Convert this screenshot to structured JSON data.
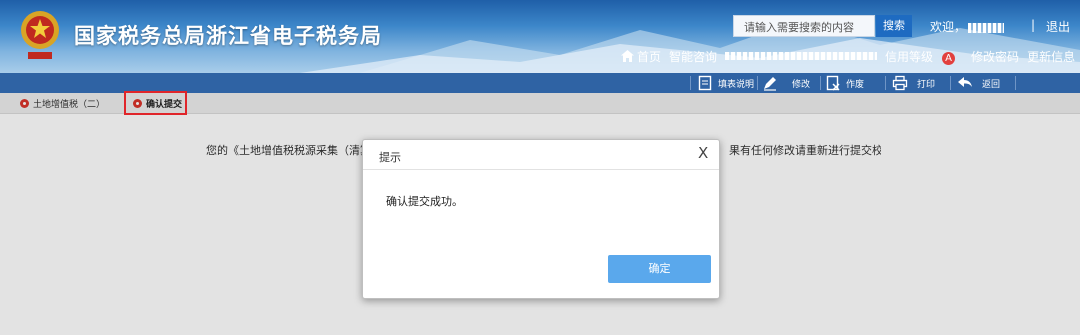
{
  "header": {
    "title": "国家税务总局浙江省电子税务局",
    "search_placeholder": "请输入需要搜索的内容",
    "search_button": "搜索",
    "welcome": "欢迎，",
    "separator": "|",
    "logout": "退出",
    "nav": {
      "home": "首页",
      "smart_consult": "智能咨询",
      "credit_level": "信用等级",
      "credit_badge": "A",
      "change_password": "修改密码",
      "update_info": "更新信息"
    }
  },
  "toolbar": {
    "fill_instructions": "填表说明",
    "modify": "修改",
    "void": "作废",
    "print": "打印",
    "back": "返回"
  },
  "tabs": [
    {
      "label": "土地增值税（二）"
    },
    {
      "label": "确认提交"
    }
  ],
  "message": {
    "before": "您的《土地增值税税源采集（清算",
    "after": "果有任何修改请重新进行提交校验!"
  },
  "dialog": {
    "title": "提示",
    "close": "X",
    "text": "确认提交成功。",
    "ok_button": "确定"
  },
  "colors": {
    "accent": "#2f63a4",
    "button": "#5aa8ec",
    "highlight": "#e0252a"
  }
}
